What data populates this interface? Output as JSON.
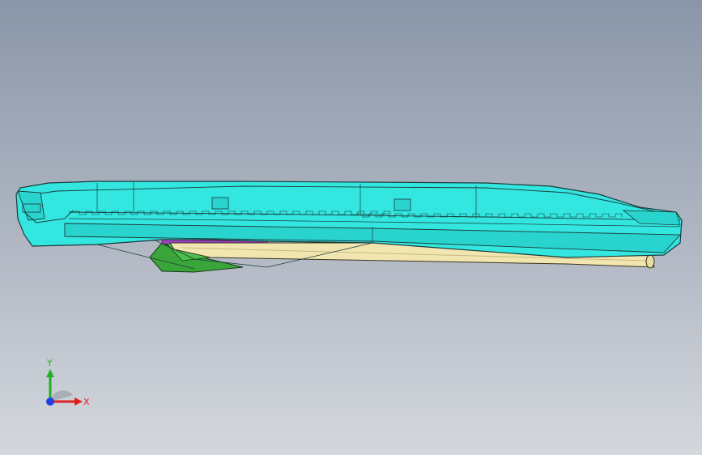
{
  "colors": {
    "background_top": "#8a96a8",
    "background_bottom": "#d4d7dd",
    "hull": "#33e6e0",
    "hull_dark": "#1fbdb8",
    "rail": "#f2e6b0",
    "bracket": "#3aa63a",
    "accent": "#a040c0",
    "edge": "#1a3a3a",
    "axis_x": "#e02020",
    "axis_y": "#20b020",
    "axis_z": "#2040e0"
  },
  "triad": {
    "x_label": "X",
    "y_label": "Y"
  },
  "icons": {
    "triad": "coordinate-triad-icon"
  }
}
